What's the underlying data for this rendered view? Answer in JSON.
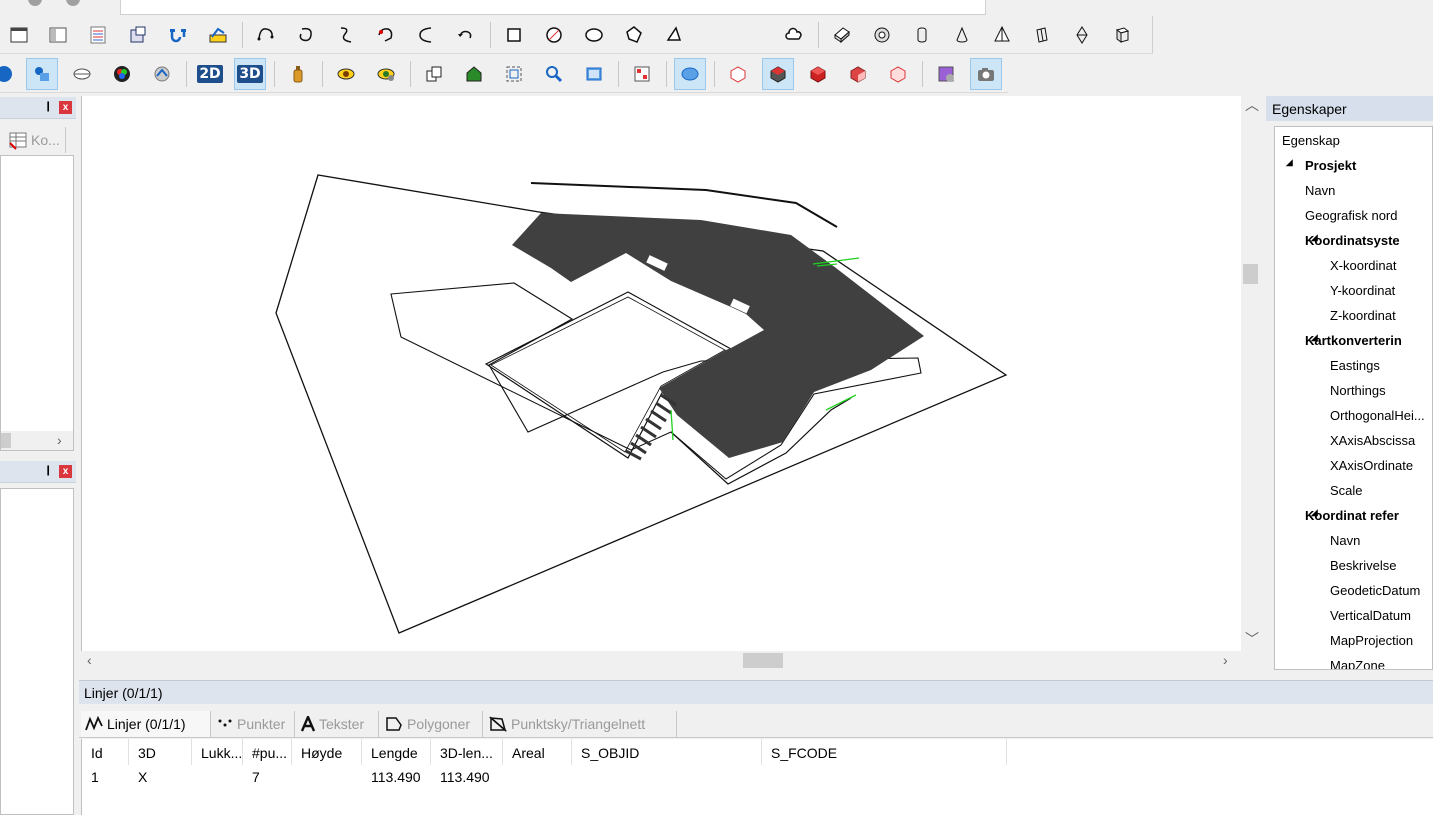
{
  "left_dock": {
    "tab_label": "Ko...",
    "pin_glyph": "❙",
    "close_glyph": "x"
  },
  "properties": {
    "title": "Egenskaper",
    "header": "Egenskap",
    "rows": [
      {
        "label": "Prosjekt",
        "level": 0,
        "bold": true,
        "expanded": true
      },
      {
        "label": "Navn",
        "level": 1,
        "bold": false
      },
      {
        "label": "Geografisk nord",
        "level": 1,
        "bold": false
      },
      {
        "label": "Koordinatsyste",
        "level": 1,
        "bold": true,
        "expanded": true
      },
      {
        "label": "X-koordinat",
        "level": 2,
        "bold": false
      },
      {
        "label": "Y-koordinat",
        "level": 2,
        "bold": false
      },
      {
        "label": "Z-koordinat",
        "level": 2,
        "bold": false
      },
      {
        "label": "Kartkonverterin",
        "level": 1,
        "bold": true,
        "expanded": true
      },
      {
        "label": "Eastings",
        "level": 2,
        "bold": false
      },
      {
        "label": "Northings",
        "level": 2,
        "bold": false
      },
      {
        "label": "OrthogonalHei...",
        "level": 2,
        "bold": false
      },
      {
        "label": "XAxisAbscissa",
        "level": 2,
        "bold": false
      },
      {
        "label": "XAxisOrdinate",
        "level": 2,
        "bold": false
      },
      {
        "label": "Scale",
        "level": 2,
        "bold": false
      },
      {
        "label": "Koordinat refer",
        "level": 1,
        "bold": true,
        "expanded": true
      },
      {
        "label": "Navn",
        "level": 2,
        "bold": false
      },
      {
        "label": "Beskrivelse",
        "level": 2,
        "bold": false
      },
      {
        "label": "GeodeticDatum",
        "level": 2,
        "bold": false
      },
      {
        "label": "VerticalDatum",
        "level": 2,
        "bold": false
      },
      {
        "label": "MapProjection",
        "level": 2,
        "bold": false
      },
      {
        "label": "MapZone",
        "level": 2,
        "bold": false
      }
    ]
  },
  "bottom": {
    "title": "Linjer (0/1/1)",
    "tabs": [
      {
        "label": "Linjer (0/1/1)",
        "icon": "polyline-icon",
        "active": true
      },
      {
        "label": "Punkter",
        "icon": "points-icon",
        "active": false
      },
      {
        "label": "Tekster",
        "icon": "text-icon",
        "active": false
      },
      {
        "label": "Polygoner",
        "icon": "polygon-icon",
        "active": false
      },
      {
        "label": "Punktsky/Triangelnett",
        "icon": "tin-icon",
        "active": false
      }
    ],
    "columns": [
      "Id",
      "3D",
      "Lukk...",
      "#pu...",
      "Høyde",
      "Lengde",
      "3D-len...",
      "Areal",
      "S_OBJID",
      "S_FCODE"
    ],
    "rows": [
      [
        "1",
        "X",
        "",
        "7",
        "",
        "113.490",
        "113.490",
        "",
        "",
        ""
      ]
    ]
  },
  "toolbar2": {
    "btn_2d": "2D",
    "btn_3d": "3D"
  },
  "colors": {
    "dark_fill": "#404040",
    "active_button": "#cde6f7",
    "green_line": "#1fd11f"
  }
}
